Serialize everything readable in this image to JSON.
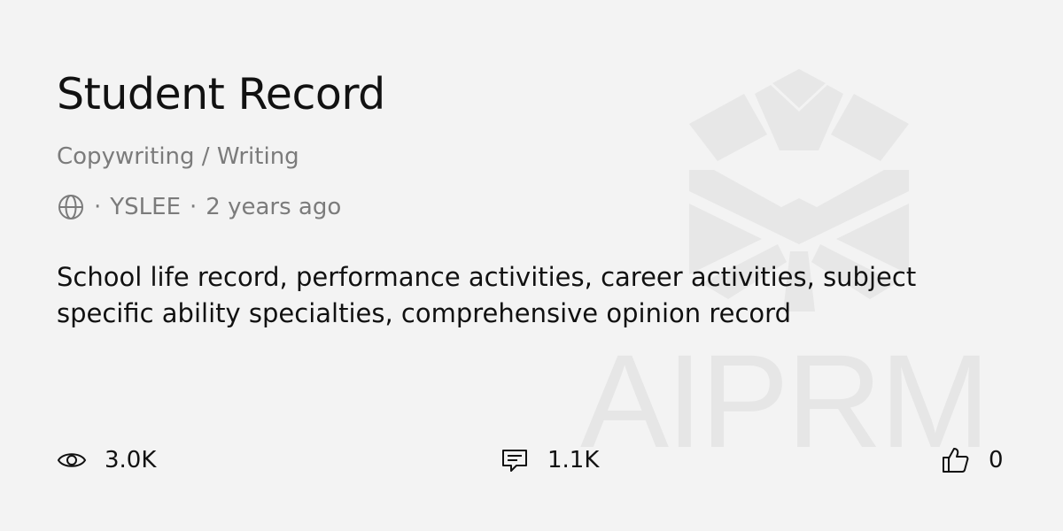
{
  "prompt": {
    "title": "Student Record",
    "category": "Copywriting / Writing",
    "visibility_icon": "globe-icon",
    "author": "YSLEE",
    "age": "2 years ago",
    "description": "School life record, performance activities, career activities, subject specific ability specialties, comprehensive opinion record"
  },
  "stats": {
    "views_icon": "eye-icon",
    "views": "3.0K",
    "comments_icon": "comment-icon",
    "comments": "1.1K",
    "likes_icon": "thumbs-up-icon",
    "likes": "0"
  },
  "brand": {
    "wordmark": "AIPRM",
    "watermark_color": "#e6e6e6"
  },
  "colors": {
    "background": "#f3f3f3",
    "text": "#111111",
    "muted": "#7b7b7b"
  }
}
